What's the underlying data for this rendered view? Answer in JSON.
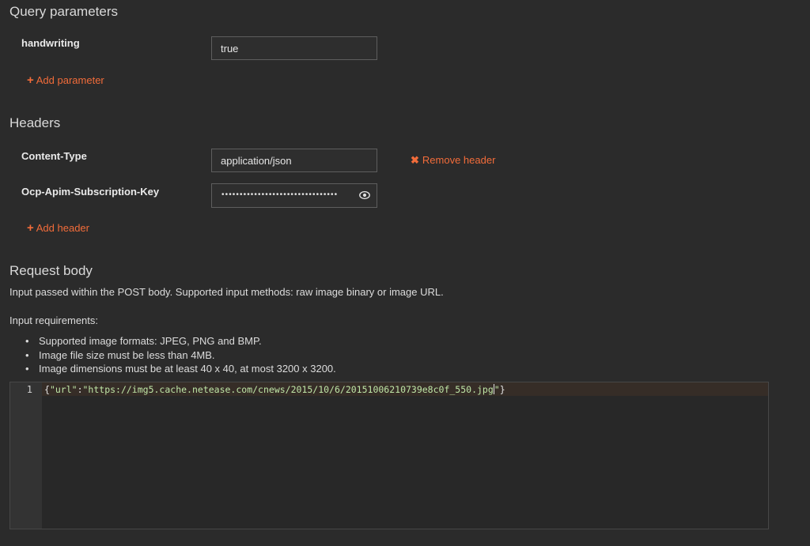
{
  "query_section": {
    "title": "Query parameters",
    "params": [
      {
        "name": "handwriting",
        "value": "true"
      }
    ],
    "add_label": "Add parameter"
  },
  "headers_section": {
    "title": "Headers",
    "headers": [
      {
        "name": "Content-Type",
        "value": "application/json",
        "remove_label": "Remove header"
      },
      {
        "name": "Ocp-Apim-Subscription-Key",
        "masked_value": "••••••••••••••••••••••••••••••••"
      }
    ],
    "add_label": "Add header"
  },
  "request_body": {
    "title": "Request body",
    "description": "Input passed within the POST body. Supported input methods: raw image binary or image URL.",
    "requirements_title": "Input requirements:",
    "requirements": [
      "Supported image formats: JPEG, PNG and BMP.",
      "Image file size must be less than 4MB.",
      "Image dimensions must be at least 40 x 40, at most 3200 x 3200."
    ],
    "editor": {
      "line_number": "1",
      "open_brace": "{",
      "key": "\"url\"",
      "colon": ":",
      "url_value": "\"https://img5.cache.netease.com/cnews/2015/10/6/20151006210739e8c0f_550.jpg",
      "closing_quote": "\"",
      "close_brace": "}"
    }
  },
  "colors": {
    "background": "#2b2b2b",
    "accent": "#f26c3a",
    "code_string": "#bfe6a7"
  }
}
